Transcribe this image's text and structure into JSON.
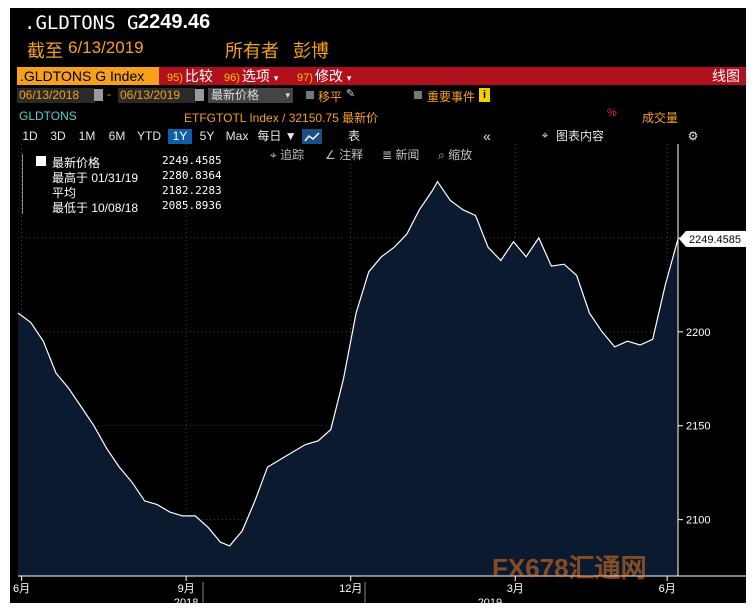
{
  "header": {
    "ticker": ".GLDTONS G",
    "price": "2249.46",
    "date_label": "截至",
    "date": "6/13/2019",
    "source_label": "所有者",
    "source": "彭博"
  },
  "toolbar": {
    "index_label": ".GLDTONS G Index",
    "compare": {
      "num": "95)",
      "label": "比较"
    },
    "options": {
      "num": "96)",
      "label": "选项"
    },
    "edit": {
      "num": "97)",
      "label": "修改"
    },
    "chart_type": "线图"
  },
  "controls": {
    "start_date": "06/13/2018",
    "dash": "-",
    "end_date": "06/13/2019",
    "price_mode": "最新价格",
    "moving_avg": "移平",
    "events": "重要事件",
    "events_badge": "i"
  },
  "series_row": {
    "name": "GLDTONS",
    "compare_text": "ETFGTOTL Index / 32150.75 最新价",
    "volume_label": "成交量"
  },
  "periods": [
    "1D",
    "3D",
    "1M",
    "6M",
    "YTD",
    "1Y",
    "5Y",
    "Max"
  ],
  "selected_period": "1Y",
  "freq_label": "每日 ▼",
  "table_label": "表",
  "collapse_icon": "«",
  "chart_content_label": "图表内容",
  "sub_toolbar": {
    "track": "追踪",
    "annotate": "注释",
    "news": "新闻",
    "zoom": "缩放"
  },
  "legend": [
    {
      "label": "最新价格",
      "value": "2249.4585"
    },
    {
      "label": "最高于 01/31/19",
      "value": "2280.8364"
    },
    {
      "label": "平均",
      "value": "2182.2283"
    },
    {
      "label": "最低于 10/08/18",
      "value": "2085.8936"
    }
  ],
  "last_value_label": "2249.4585",
  "watermark": "FX678汇通网",
  "colors": {
    "accent": "#f5a11b",
    "bar_red": "#b1111c",
    "fill": "#0b1a2f",
    "line": "#ffffff"
  },
  "chart_data": {
    "type": "area",
    "title": ".GLDTONS G",
    "ylim": [
      2070,
      2300
    ],
    "y_ticks": [
      2100,
      2150,
      2200,
      2250
    ],
    "y_tick_labels": [
      "2100",
      "2150",
      "2200",
      ""
    ],
    "x_range": [
      "2018-06-13",
      "2019-06-13"
    ],
    "x_ticks": [
      {
        "date": "2018-06-15",
        "label": "6月"
      },
      {
        "date": "2018-09-14",
        "label": "9月"
      },
      {
        "date": "2018-12-14",
        "label": "12月"
      },
      {
        "date": "2019-03-15",
        "label": "3月"
      },
      {
        "date": "2019-06-07",
        "label": "6月"
      }
    ],
    "year_labels": [
      {
        "date": "2018-09-14",
        "label": "2018"
      },
      {
        "date": "2019-03-01",
        "label": "2019"
      }
    ],
    "grid": true,
    "series": [
      {
        "name": "GLDTONS",
        "x": [
          "2018-06-13",
          "2018-06-20",
          "2018-06-27",
          "2018-07-04",
          "2018-07-11",
          "2018-07-18",
          "2018-07-25",
          "2018-08-01",
          "2018-08-08",
          "2018-08-15",
          "2018-08-22",
          "2018-08-29",
          "2018-09-05",
          "2018-09-12",
          "2018-09-19",
          "2018-09-26",
          "2018-10-03",
          "2018-10-08",
          "2018-10-15",
          "2018-10-22",
          "2018-10-29",
          "2018-11-05",
          "2018-11-12",
          "2018-11-19",
          "2018-11-26",
          "2018-12-03",
          "2018-12-10",
          "2018-12-17",
          "2018-12-24",
          "2018-12-31",
          "2019-01-07",
          "2019-01-14",
          "2019-01-21",
          "2019-01-28",
          "2019-01-31",
          "2019-02-07",
          "2019-02-14",
          "2019-02-21",
          "2019-02-28",
          "2019-03-07",
          "2019-03-14",
          "2019-03-21",
          "2019-03-28",
          "2019-04-04",
          "2019-04-11",
          "2019-04-18",
          "2019-04-25",
          "2019-05-02",
          "2019-05-09",
          "2019-05-16",
          "2019-05-23",
          "2019-05-30",
          "2019-06-06",
          "2019-06-13"
        ],
        "values": [
          2210,
          2205,
          2195,
          2178,
          2170,
          2160,
          2150,
          2138,
          2128,
          2120,
          2110,
          2108,
          2104,
          2102,
          2102,
          2096,
          2088,
          2086,
          2094,
          2110,
          2128,
          2132,
          2136,
          2140,
          2142,
          2148,
          2175,
          2210,
          2232,
          2240,
          2245,
          2252,
          2265,
          2275,
          2280,
          2270,
          2265,
          2262,
          2245,
          2238,
          2248,
          2240,
          2250,
          2235,
          2236,
          2230,
          2210,
          2200,
          2192,
          2195,
          2193,
          2196,
          2225,
          2249.46
        ]
      }
    ]
  }
}
